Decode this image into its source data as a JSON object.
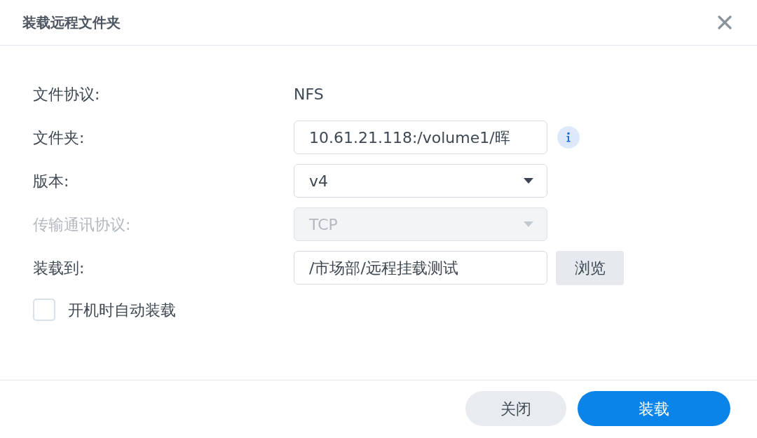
{
  "dialog": {
    "title": "装载远程文件夹"
  },
  "fields": [
    {
      "kind": "text",
      "label": "文件协议:",
      "value": "NFS",
      "disabled": false
    },
    {
      "kind": "input",
      "label": "文件夹:",
      "value": "10.61.21.118:/volume1/晖",
      "disabled": false,
      "info": true
    },
    {
      "kind": "select",
      "label": "版本:",
      "value": "v4",
      "disabled": false
    },
    {
      "kind": "select",
      "label": "传输通讯协议:",
      "value": "TCP",
      "disabled": true
    },
    {
      "kind": "input",
      "label": "装载到:",
      "value": "/市场部/远程挂载测试",
      "disabled": false,
      "button": "浏览"
    }
  ],
  "auto_mount": {
    "label": "开机时自动装载",
    "checked": false
  },
  "buttons": [
    {
      "label": "关闭",
      "kind": "secondary"
    },
    {
      "label": "装载",
      "kind": "primary"
    }
  ]
}
